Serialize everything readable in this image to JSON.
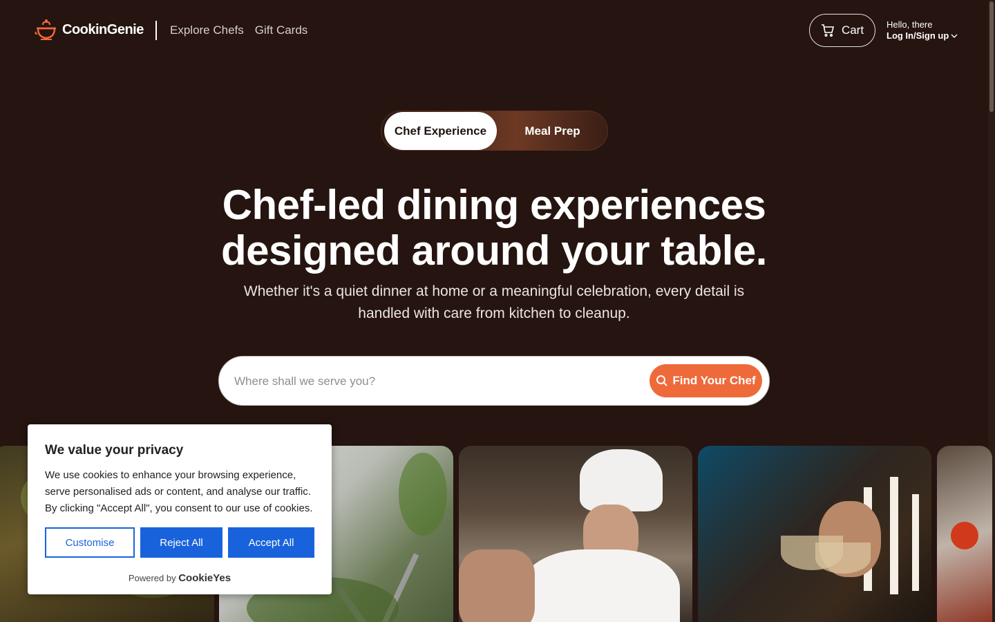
{
  "header": {
    "brand": "CookinGenie",
    "nav": [
      "Explore Chefs",
      "Gift Cards"
    ],
    "cart_label": "Cart",
    "greeting": "Hello, there",
    "login_label": "Log In/Sign up"
  },
  "toggle": {
    "active": "Chef Experience",
    "inactive": "Meal Prep"
  },
  "hero": {
    "title_line1": "Chef-led dining experiences",
    "title_line2": "designed around your table.",
    "subtitle": "Whether it's a quiet dinner at home or a meaningful celebration, every detail is handled with care from kitchen to cleanup."
  },
  "search": {
    "placeholder": "Where shall we serve you?",
    "button_label": "Find Your Chef"
  },
  "cookie_banner": {
    "title": "We value your privacy",
    "body": "We use cookies to enhance your browsing experience, serve personalised ads or content, and analyse our traffic. By clicking \"Accept All\", you consent to our use of cookies.",
    "customise": "Customise",
    "reject": "Reject All",
    "accept": "Accept All",
    "powered_by": "Powered by",
    "powered_brand": "CookieYes"
  },
  "colors": {
    "background": "#251410",
    "accent": "#ef6a3a",
    "cookie_blue": "#1863dc"
  },
  "icons": [
    "chef-pot-logo-icon",
    "cart-icon",
    "chevron-down-icon",
    "search-icon"
  ]
}
